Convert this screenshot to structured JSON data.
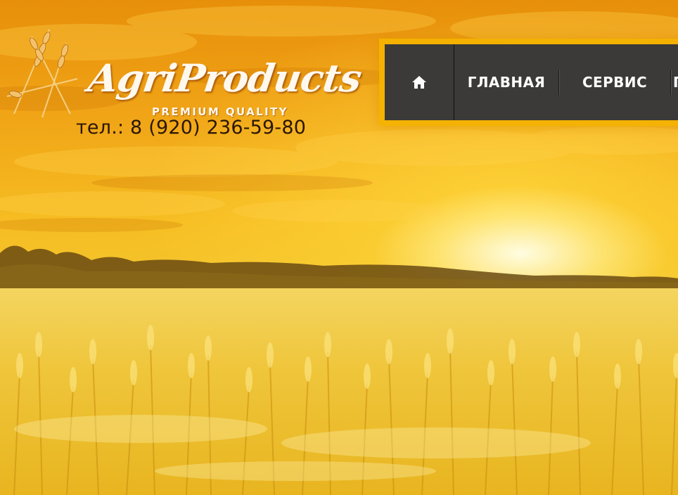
{
  "brand": {
    "name": "AgriProducts",
    "tagline": "PREMIUM QUALITY"
  },
  "contact": {
    "phone": "тел.: 8 (920) 236-59-80"
  },
  "nav": {
    "home_icon": "home-icon",
    "items": [
      {
        "label": "ГЛАВНАЯ"
      },
      {
        "label": "СЕРВИС"
      },
      {
        "label": "П"
      }
    ]
  },
  "colors": {
    "nav_bg": "#3b3a39",
    "nav_text": "#ffffff",
    "logo_text": "#fff8ee",
    "phone_text": "#2a1604",
    "sky_orange": "#e78f0a",
    "field_gold": "#f2c830"
  }
}
